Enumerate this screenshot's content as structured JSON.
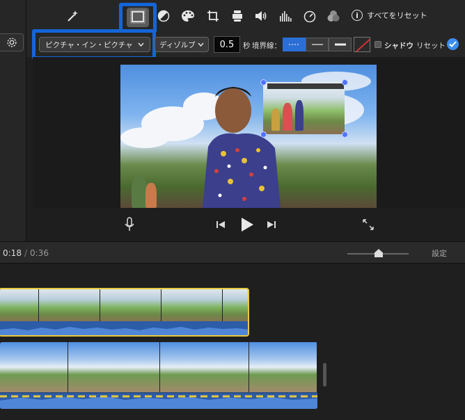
{
  "toolbar": {
    "tools": [
      {
        "name": "enhance-magic-wand",
        "selected": false
      },
      {
        "name": "picture-in-picture",
        "selected": true
      },
      {
        "name": "color-balance",
        "selected": false
      },
      {
        "name": "color-correction",
        "selected": false
      },
      {
        "name": "crop",
        "selected": false
      },
      {
        "name": "stabilization",
        "selected": false
      },
      {
        "name": "volume",
        "selected": false
      },
      {
        "name": "noise-reduction-equalizer",
        "selected": false
      },
      {
        "name": "speed",
        "selected": false
      },
      {
        "name": "clip-filter",
        "selected": false
      }
    ],
    "info_glyph": "i",
    "reset_all_label": "すべてをリセット"
  },
  "options": {
    "overlay_type": "ピクチャ・イン・ピクチャ",
    "transition_style": "ディゾルブ",
    "duration_value": "0.5",
    "duration_unit": "秒",
    "border_label": "境界線：",
    "border_options": [
      "none",
      "thin",
      "thick"
    ],
    "border_selected": "none",
    "border_color": "#d13030",
    "shadow_label": "シャドウ",
    "shadow_checked": false,
    "reset_label": "リセット",
    "accent_color": "#3d8ef0",
    "highlight_color": "#1565d8"
  },
  "transport": {
    "mic_icon": "microphone-icon",
    "prev_icon": "skip-back-icon",
    "play_icon": "play-icon",
    "next_icon": "skip-forward-icon",
    "fullscreen_icon": "fullscreen-icon"
  },
  "timeline": {
    "current_time": "0:18",
    "separator": "/",
    "total_time": "0:36",
    "settings_label": "設定",
    "selected_clip_color": "#e8c93a"
  }
}
